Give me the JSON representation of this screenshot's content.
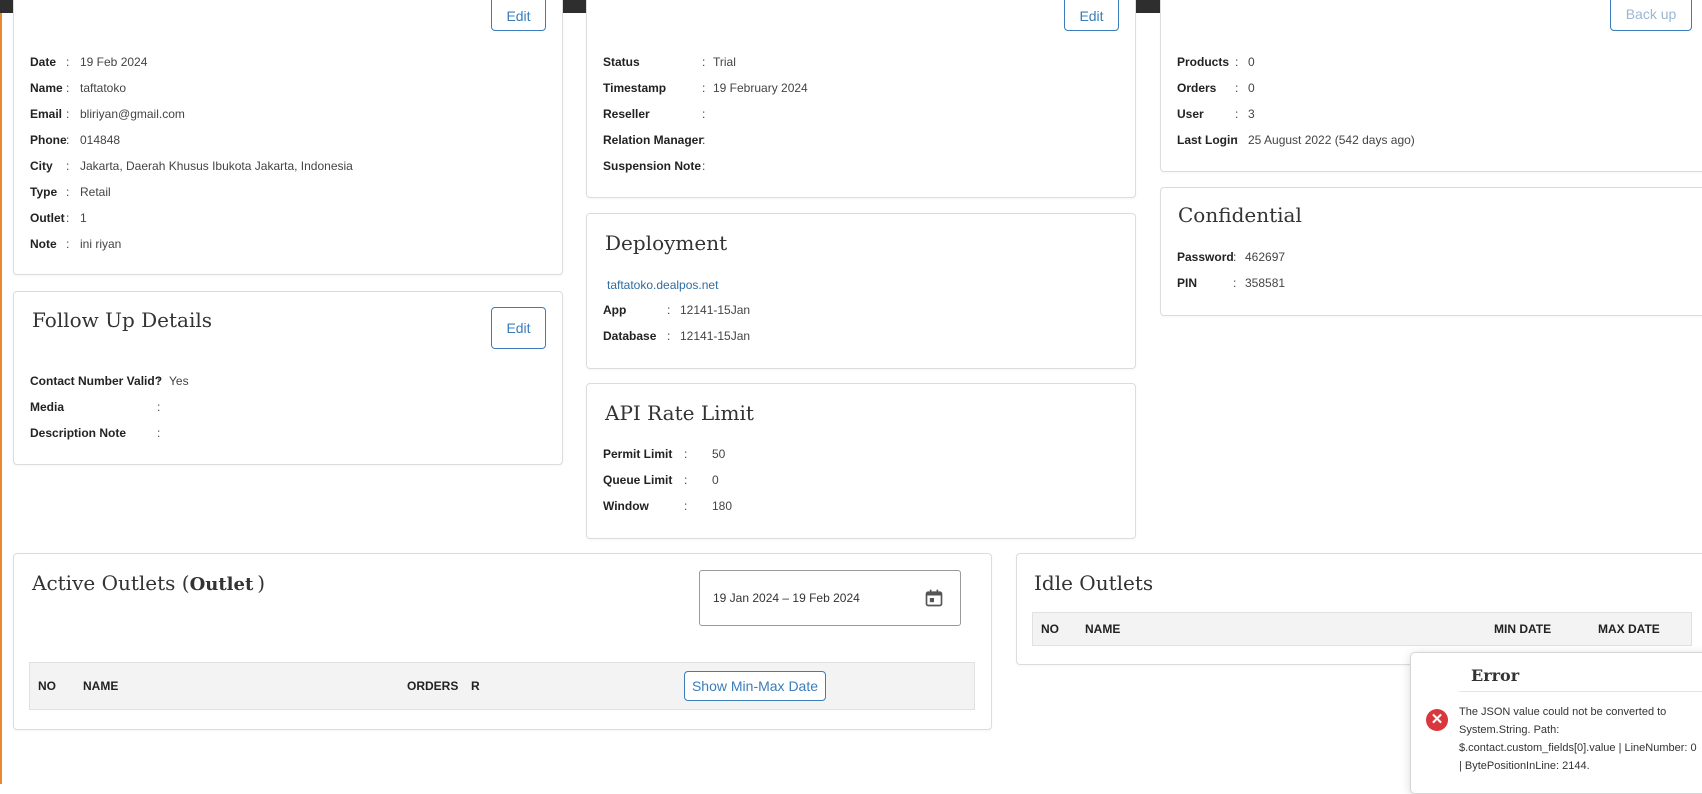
{
  "customer": {
    "edit_label": "Edit",
    "fields": [
      {
        "label": "Date",
        "value": "19 Feb 2024"
      },
      {
        "label": "Name",
        "value": "taftatoko"
      },
      {
        "label": "Email",
        "value": "bliriyan@gmail.com"
      },
      {
        "label": "Phone",
        "value": "014848"
      },
      {
        "label": "City",
        "value": "Jakarta, Daerah Khusus Ibukota Jakarta, Indonesia"
      },
      {
        "label": "Type",
        "value": "Retail"
      },
      {
        "label": "Outlet",
        "value": "1"
      },
      {
        "label": "Note",
        "value": "ini riyan"
      }
    ]
  },
  "subscription": {
    "edit_label": "Edit",
    "fields": [
      {
        "label": "Status",
        "value": "Trial"
      },
      {
        "label": "Timestamp",
        "value": "19 February 2024"
      },
      {
        "label": "Reseller",
        "value": ""
      },
      {
        "label": "Relation Manager",
        "value": ""
      },
      {
        "label": "Suspension Note",
        "value": ""
      }
    ]
  },
  "stats": {
    "button_label": "Back up",
    "fields": [
      {
        "label": "Products",
        "value": "0"
      },
      {
        "label": "Orders",
        "value": "0"
      },
      {
        "label": "User",
        "value": "3"
      },
      {
        "label": "Last Login",
        "value": "25 August 2022 (542 days ago)"
      }
    ]
  },
  "follow_up": {
    "title": "Follow Up Details",
    "edit_label": "Edit",
    "fields": [
      {
        "label": "Contact Number Valid?",
        "value": "Yes"
      },
      {
        "label": "Media",
        "value": ""
      },
      {
        "label": "Description Note",
        "value": ""
      }
    ]
  },
  "deployment": {
    "title": "Deployment",
    "url": "taftatoko.dealpos.net",
    "fields": [
      {
        "label": "App",
        "value": "12141-15Jan"
      },
      {
        "label": "Database",
        "value": "12141-15Jan"
      }
    ]
  },
  "api_rate_limit": {
    "title": "API Rate Limit",
    "fields": [
      {
        "label": "Permit Limit",
        "value": "50"
      },
      {
        "label": "Queue Limit",
        "value": "0"
      },
      {
        "label": "Window",
        "value": "180"
      }
    ]
  },
  "confidential": {
    "title": "Confidential",
    "fields": [
      {
        "label": "Password",
        "value": "462697"
      },
      {
        "label": "PIN",
        "value": "358581"
      }
    ]
  },
  "active_outlets": {
    "title_prefix": "Active Outlets (",
    "title_bold": "Outlet",
    "title_suffix": ")",
    "date_range": "19 Jan 2024 – 19 Feb 2024",
    "columns": {
      "no": "NO",
      "name": "NAME",
      "orders": "ORDERS",
      "r": "R"
    },
    "show_button": "Show Min-Max Date"
  },
  "idle_outlets": {
    "title": "Idle Outlets",
    "columns": {
      "no": "NO",
      "name": "NAME",
      "min_date": "MIN DATE",
      "max_date": "MAX DATE"
    }
  },
  "error_toast": {
    "title": "Error",
    "icon": "error-x-icon",
    "message": "The JSON value could not be converted to System.String. Path: $.contact.custom_fields[0].value | LineNumber: 0 | BytePositionInLine: 2144."
  },
  "colors": {
    "accent": "#3b7dbb",
    "error": "#d9363e",
    "topbar": "#2e2e2e",
    "edge": "#e8892f"
  }
}
